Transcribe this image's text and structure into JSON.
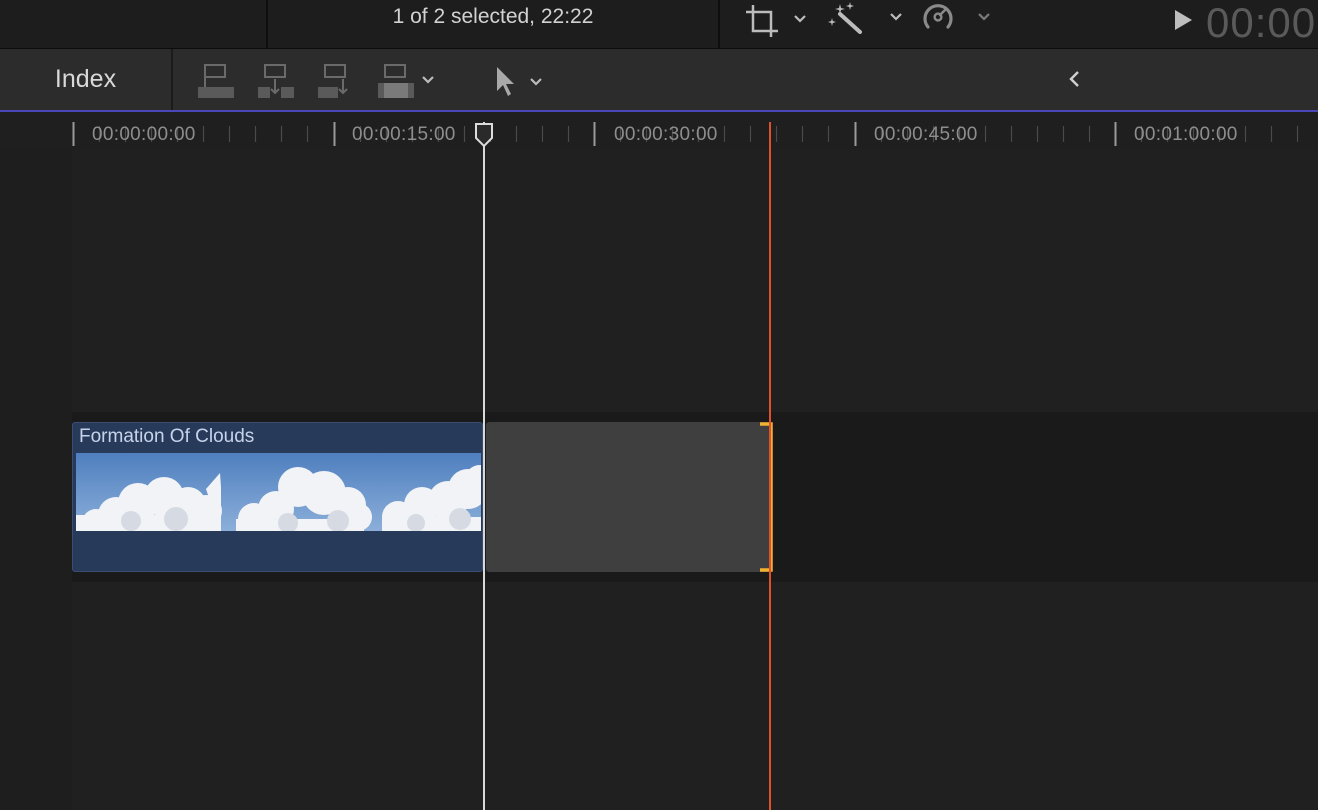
{
  "topbar": {
    "selection_info": "1 of 2 selected, 22:22",
    "icons": [
      "crop-icon",
      "magic-wand-icon",
      "speedometer-icon",
      "play-icon"
    ],
    "timecode": "00:00"
  },
  "toolbar": {
    "index_label": "Index",
    "tools": [
      "connect-clip-icon",
      "insert-clip-icon",
      "append-clip-icon",
      "overwrite-clip-icon",
      "select-tool-icon",
      "collapse-icon"
    ]
  },
  "ruler": {
    "labels": [
      "00:00:00:00",
      "00:00:15:00",
      "00:00:30:00",
      "00:00:45:00",
      "00:01:00:00"
    ]
  },
  "timeline": {
    "clip_title": "Formation Of Clouds"
  },
  "colors": {
    "accent_blue": "#4a48b8",
    "clip_blue": "#283a5a",
    "trim_yellow": "#f2b132",
    "skimmer_red": "#e0502a"
  }
}
